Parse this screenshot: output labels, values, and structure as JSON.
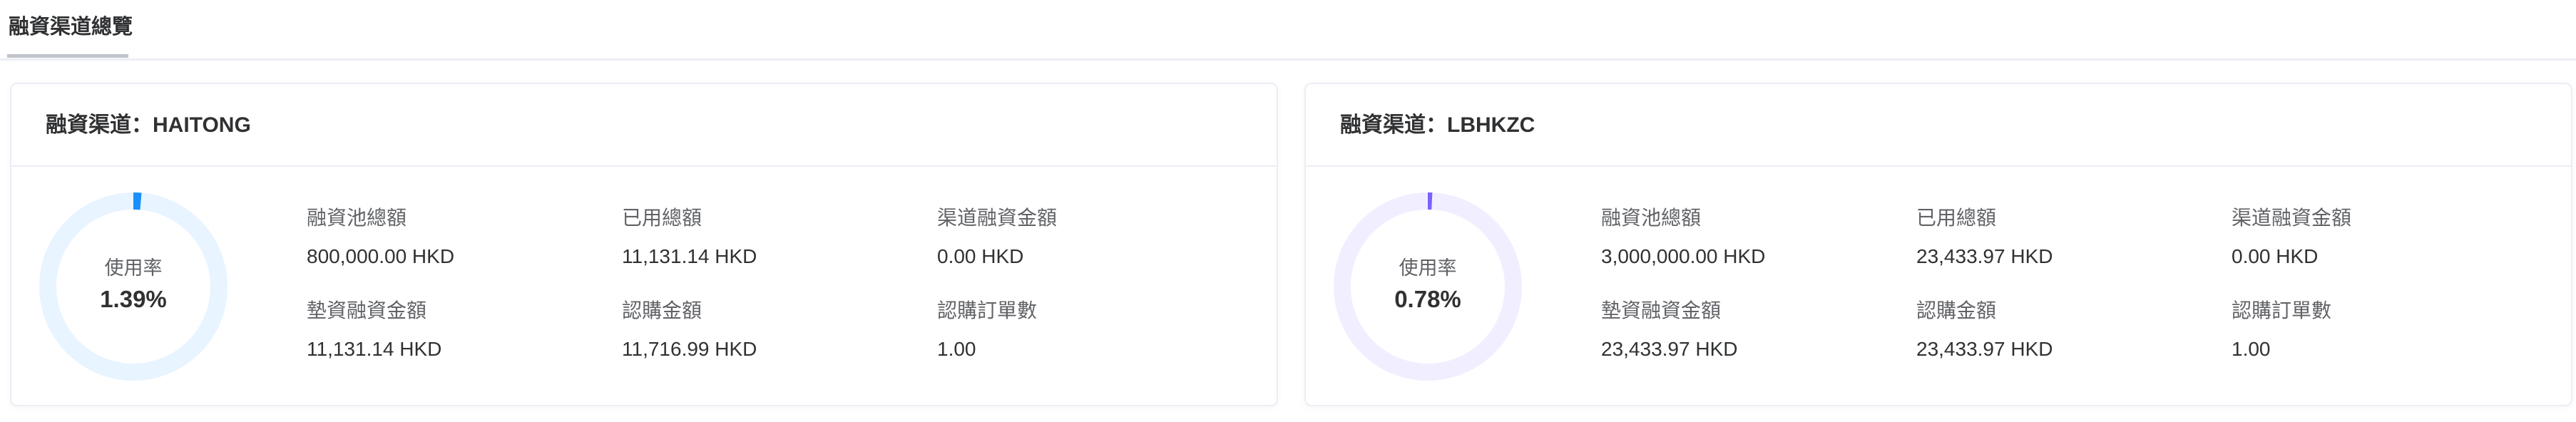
{
  "tab": {
    "label": "融資渠道總覽"
  },
  "cards": [
    {
      "title": "融資渠道：HAITONG",
      "usage_label": "使用率",
      "usage_value": "1.39%",
      "usage_fraction": 0.0139,
      "accent": "#1890ff",
      "track": "#e8f4ff",
      "stats": [
        {
          "label": "融資池總額",
          "value": "800,000.00 HKD"
        },
        {
          "label": "已用總額",
          "value": "11,131.14 HKD"
        },
        {
          "label": "渠道融資金額",
          "value": "0.00 HKD"
        },
        {
          "label": "墊資融資金額",
          "value": "11,131.14 HKD"
        },
        {
          "label": "認購金額",
          "value": "11,716.99 HKD"
        },
        {
          "label": "認購訂單數",
          "value": "1.00"
        }
      ]
    },
    {
      "title": "融資渠道：LBHKZC",
      "usage_label": "使用率",
      "usage_value": "0.78%",
      "usage_fraction": 0.0078,
      "accent": "#7b61ff",
      "track": "#f1efff",
      "stats": [
        {
          "label": "融資池總額",
          "value": "3,000,000.00 HKD"
        },
        {
          "label": "已用總額",
          "value": "23,433.97 HKD"
        },
        {
          "label": "渠道融資金額",
          "value": "0.00 HKD"
        },
        {
          "label": "墊資融資金額",
          "value": "23,433.97 HKD"
        },
        {
          "label": "認購金額",
          "value": "23,433.97 HKD"
        },
        {
          "label": "認購訂單數",
          "value": "1.00"
        }
      ]
    }
  ]
}
